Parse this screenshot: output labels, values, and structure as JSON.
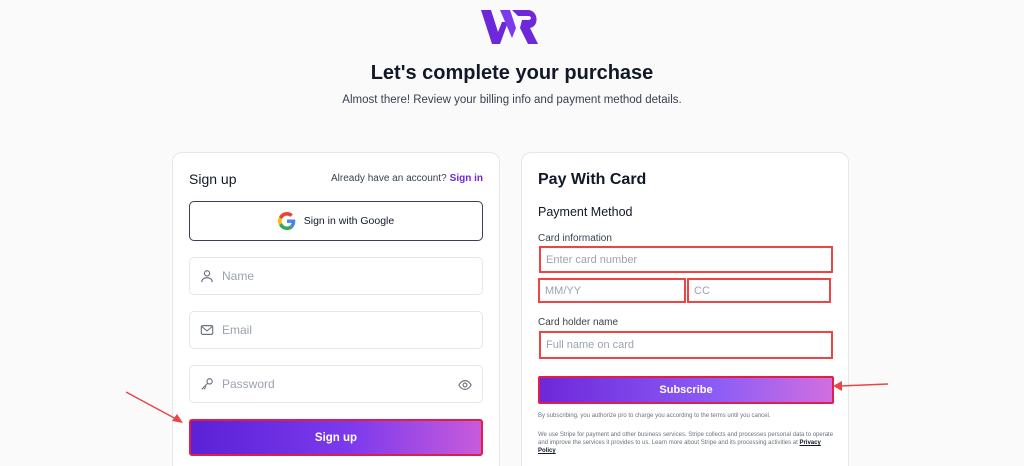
{
  "header": {
    "logo_text": "WR",
    "title": "Let's complete your purchase",
    "subtitle": "Almost there! Review your billing info and payment method details."
  },
  "signup": {
    "heading": "Sign up",
    "already_text": "Already have an account?",
    "signin_link": "Sign in",
    "google_label": "Sign in with Google",
    "name_placeholder": "Name",
    "email_placeholder": "Email",
    "password_placeholder": "Password",
    "submit_label": "Sign up"
  },
  "payment": {
    "heading": "Pay With Card",
    "method_label": "Payment Method",
    "card_info_label": "Card information",
    "card_number_placeholder": "Enter card number",
    "expiry_placeholder": "MM/YY",
    "cvc_placeholder": "CC",
    "holder_label": "Card holder name",
    "holder_placeholder": "Full name on card",
    "subscribe_label": "Subscribe",
    "terms_text": "By subscribing, you authorize pro to charge you according to the terms until you cancel.",
    "stripe_text": "We use Stripe for payment and other business services. Stripe collects and processes personal data to operate and improve the services it provides to us. Learn more about Stripe and its processing activities at",
    "privacy_link": "Privacy Policy"
  },
  "colors": {
    "accent": "#6d28d9",
    "highlight": "#ef4444"
  }
}
